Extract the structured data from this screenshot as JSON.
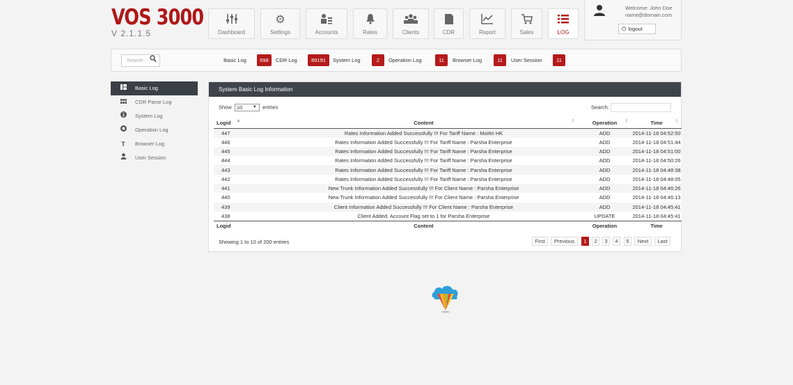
{
  "logo": {
    "title": "VOS 3000",
    "version": "V 2.1.1.5"
  },
  "nav": [
    {
      "label": "Dashboard",
      "icon": "sliders-icon"
    },
    {
      "label": "Settings",
      "icon": "gears-icon"
    },
    {
      "label": "Accounts",
      "icon": "accounts-icon"
    },
    {
      "label": "Rates",
      "icon": "bell-icon"
    },
    {
      "label": "Clients",
      "icon": "clients-icon"
    },
    {
      "label": "CDR",
      "icon": "document-icon"
    },
    {
      "label": "Report",
      "icon": "chart-icon"
    },
    {
      "label": "Sales",
      "icon": "cart-icon"
    },
    {
      "label": "LOG",
      "icon": "log-list-icon",
      "active": true
    }
  ],
  "user": {
    "welcome": "Welcome: John Doe",
    "email": "name@domain.com",
    "logout": "logout"
  },
  "toolbar": {
    "search_placeholder": "Search",
    "tabs": [
      {
        "label": "Basic Log",
        "count": "698"
      },
      {
        "label": "CDR Log",
        "count": "89191"
      },
      {
        "label": "System Log",
        "count": "2"
      },
      {
        "label": "Operation Log",
        "count": "11"
      },
      {
        "label": "Browser Log",
        "count": "11"
      },
      {
        "label": "User Session",
        "count": "11"
      }
    ]
  },
  "sidebar": {
    "items": [
      {
        "label": "Basic Log",
        "icon": "grid-icon",
        "active": true
      },
      {
        "label": "CDR Parse Log",
        "icon": "table-icon"
      },
      {
        "label": "System Log",
        "icon": "info-icon"
      },
      {
        "label": "Operation Log",
        "icon": "record-icon"
      },
      {
        "label": "Browser Log",
        "icon": "text-icon"
      },
      {
        "label": "User Session",
        "icon": "user-icon"
      }
    ]
  },
  "panel": {
    "title": "System Basic Log Information",
    "show_label": "Show",
    "entries_value": "10",
    "entries_label": "entries",
    "search_label": "Search:",
    "columns": [
      "Logid",
      "Content",
      "Operation",
      "Time"
    ],
    "rows": [
      {
        "id": "447",
        "content": "Rates Information Added Successfully !!! For Tariff Name : Moittri HK",
        "op": "ADD",
        "time": "2014-11-18 04:52:50"
      },
      {
        "id": "446",
        "content": "Rates Information Added Successfully !!! For Tariff Name : Parsha Enterprise",
        "op": "ADD",
        "time": "2014-11-18 04:51:44"
      },
      {
        "id": "445",
        "content": "Rates Information Added Successfully !!! For Tariff Name : Parsha Enterprise",
        "op": "ADD",
        "time": "2014-11-18 04:51:00"
      },
      {
        "id": "444",
        "content": "Rates Information Added Successfully !!! For Tariff Name : Parsha Enterprise",
        "op": "ADD",
        "time": "2014-11-18 04:50:26"
      },
      {
        "id": "443",
        "content": "Rates Information Added Successfully !!! For Tariff Name : Parsha Enterprise",
        "op": "ADD",
        "time": "2014-11-18 04:48:38"
      },
      {
        "id": "442",
        "content": "Rates Information Added Successfully !!! For Tariff Name : Parsha Enterprise",
        "op": "ADD",
        "time": "2014-11-18 04:48:05"
      },
      {
        "id": "441",
        "content": "New Trunk Information Added Successfully !!! For Client Name : Parsha Enterprise",
        "op": "ADD",
        "time": "2014-11-18 04:46:26"
      },
      {
        "id": "440",
        "content": "New Trunk Information Added Successfully !!! For Client Name : Parsha Enterprise",
        "op": "ADD",
        "time": "2014-11-18 04:46:13"
      },
      {
        "id": "439",
        "content": "Client Information Added Successfully !!! For Client Name : Parsha Enterprise",
        "op": "ADD",
        "time": "2014-11-18 04:45:41"
      },
      {
        "id": "438",
        "content": "Client Added. Account Flag set to 1 for Parsha Enterprise",
        "op": "UPDATE",
        "time": "2014-11-18 04:45:41"
      }
    ],
    "showing": "Showing 1 to 10 of 200 entries",
    "pager": [
      "First",
      "Previous",
      "1",
      "2",
      "3",
      "4",
      "5",
      "Next",
      "Last"
    ],
    "current_page": "1"
  },
  "colors": {
    "brand_red": "#b01717",
    "badge_red": "#b51a1a",
    "panel_head": "#3f444b",
    "op_add": "#2c38c9",
    "op_update": "#e89a10"
  }
}
